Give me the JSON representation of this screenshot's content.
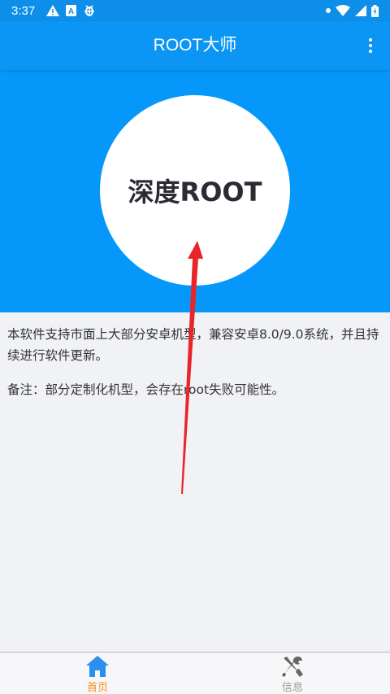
{
  "status_bar": {
    "time": "3:37",
    "left_icons": [
      "warning-icon",
      "a-notification-icon",
      "bug-icon"
    ],
    "right_icons": [
      "dot-icon",
      "wifi-icon",
      "signal-icon",
      "battery-icon"
    ]
  },
  "app_bar": {
    "title": "ROOT大师",
    "menu_icon": "more-vert-icon"
  },
  "hero": {
    "button_label": "深度ROOT",
    "background_color": "#0598fa"
  },
  "content": {
    "description": "本软件支持市面上大部分安卓机型，兼容安卓8.0/9.0系统，并且持续进行软件更新。",
    "note": "备注：部分定制化机型，会存在root失败可能性。"
  },
  "bottom_nav": {
    "items": [
      {
        "label": "首页",
        "icon": "home-icon",
        "active": true,
        "color": "#f5901e"
      },
      {
        "label": "信息",
        "icon": "tools-icon",
        "active": false,
        "color": "#999999"
      }
    ]
  },
  "colors": {
    "primary": "#0b95f4",
    "accent": "#f5901e",
    "annotation_arrow": "#e8262a"
  }
}
